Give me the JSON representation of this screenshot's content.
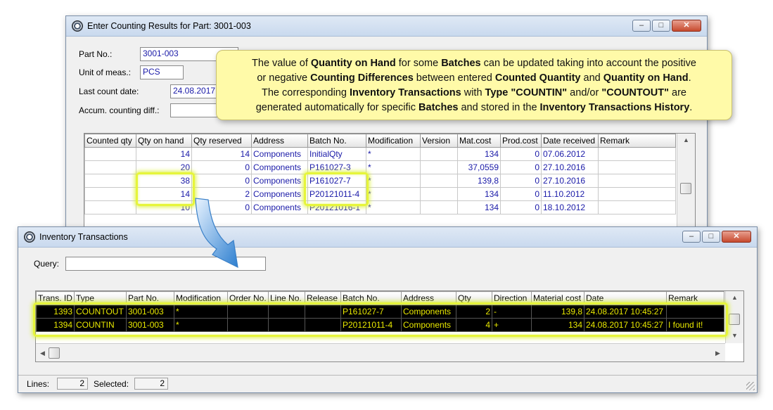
{
  "win1": {
    "title": "Enter Counting Results for Part: 3001-003",
    "labels": {
      "part_no": "Part No.:",
      "unit": "Unit of meas.:",
      "last_count": "Last count date:",
      "accum": "Accum. counting diff.:"
    },
    "values": {
      "part_no": "3001-003",
      "unit": "PCS",
      "last_count": "24.08.2017"
    },
    "columns": [
      "Counted qty",
      "Qty on hand",
      "Qty reserved",
      "Address",
      "Batch No.",
      "Modification",
      "Version",
      "Mat.cost",
      "Prod.cost",
      "Date received",
      "Remark"
    ],
    "rows": [
      [
        "",
        "14",
        "14",
        "Components",
        "InitialQty",
        "*",
        "",
        "134",
        "0",
        "07.06.2012",
        ""
      ],
      [
        "",
        "20",
        "0",
        "Components",
        "P161027-3",
        "*",
        "",
        "37,0559",
        "0",
        "27.10.2016",
        ""
      ],
      [
        "",
        "38",
        "0",
        "Components",
        "P161027-7",
        "*",
        "",
        "139,8",
        "0",
        "27.10.2016",
        ""
      ],
      [
        "",
        "14",
        "2",
        "Components",
        "P20121011-4",
        "*",
        "",
        "134",
        "0",
        "11.10.2012",
        ""
      ],
      [
        "",
        "10",
        "0",
        "Components",
        "P20121016-1",
        "*",
        "",
        "134",
        "0",
        "18.10.2012",
        ""
      ]
    ]
  },
  "callout": {
    "l1": [
      "The value of ",
      "Quantity on Hand",
      " for some ",
      "Batches",
      " can be updated taking into account the positive"
    ],
    "l2": [
      "or negative ",
      "Counting Differences",
      " between entered ",
      "Counted Quantity",
      " and ",
      "Quantity on Hand",
      "."
    ],
    "l3": [
      "The corresponding ",
      "Inventory Transactions",
      " with ",
      "Type \"COUNTIN\"",
      " and/or ",
      "\"COUNTOUT\"",
      " are"
    ],
    "l4": [
      "generated automatically for specific ",
      "Batches",
      " and stored in the ",
      "Inventory Transactions  History",
      "."
    ]
  },
  "win2": {
    "title": "Inventory Transactions",
    "query_label": "Query:",
    "query_value": "",
    "columns": [
      "Trans. ID",
      "Type",
      "Part No.",
      "Modification",
      "Order No.",
      "Line No.",
      "Release",
      "Batch No.",
      "Address",
      "Qty",
      "Direction",
      "Material cost",
      "Date",
      "Remark"
    ],
    "rows": [
      [
        "1393",
        "COUNTOUT",
        "3001-003",
        "*",
        "",
        "",
        "",
        "P161027-7",
        "Components",
        "2",
        "-",
        "139,8",
        "24.08.2017 10:45:27",
        ""
      ],
      [
        "1394",
        "COUNTIN",
        "3001-003",
        "*",
        "",
        "",
        "",
        "P20121011-4",
        "Components",
        "4",
        "+",
        "134",
        "24.08.2017 10:45:27",
        "I found it!"
      ]
    ],
    "status": {
      "lines_label": "Lines:",
      "lines_value": "2",
      "selected_label": "Selected:",
      "selected_value": "2"
    }
  },
  "colors": {
    "highlight": "#e6f53a",
    "callout_bg": "#fffaa8",
    "arrow": "#3a8fd8"
  }
}
